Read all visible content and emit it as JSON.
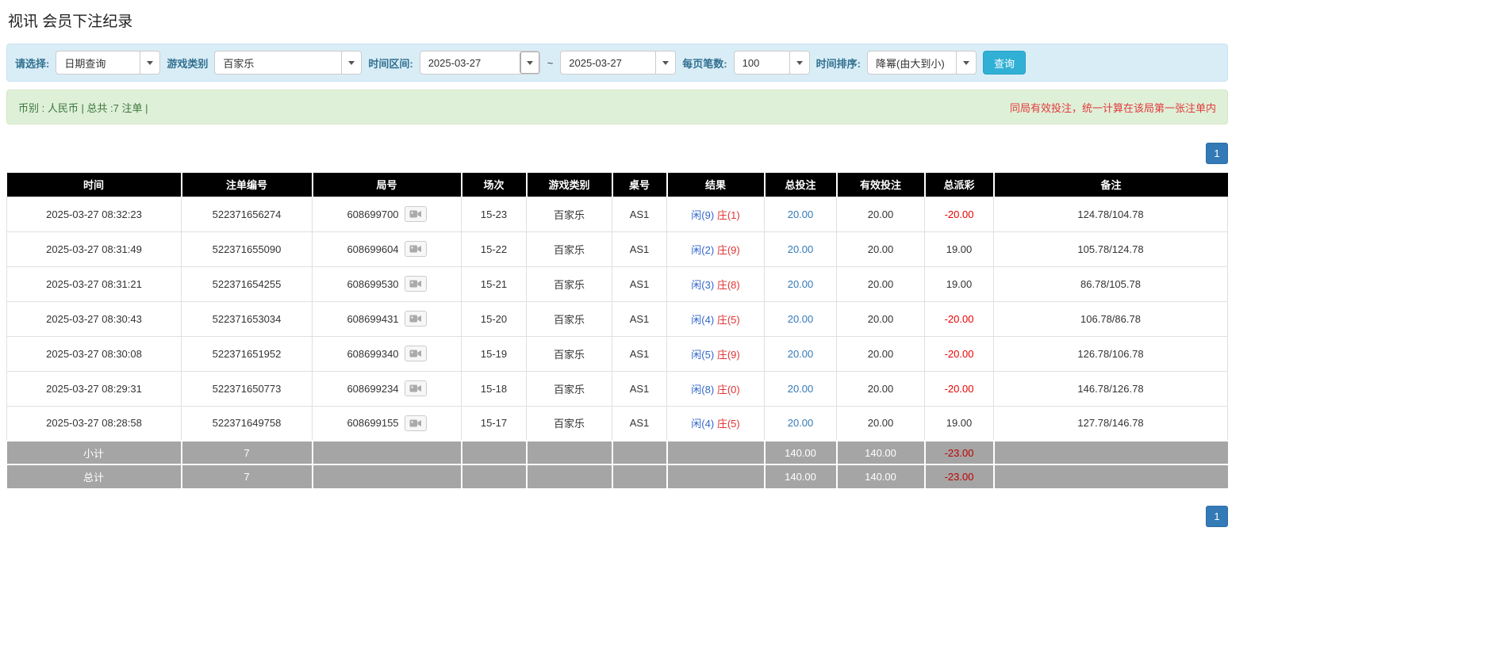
{
  "page": {
    "title": "视讯 会员下注纪录"
  },
  "filters": {
    "select_label": "请选择:",
    "select_value": "日期查询",
    "game_type_label": "游戏类别",
    "game_type_value": "百家乐",
    "time_range_label": "时间区间:",
    "date_from": "2025-03-27",
    "date_separator": "~",
    "date_to": "2025-03-27",
    "page_size_label": "每页笔数:",
    "page_size_value": "100",
    "sort_label": "时间排序:",
    "sort_value": "降幂(由大到小)",
    "query_button_label": "查询"
  },
  "summary_bar": {
    "left_text": "币别 : 人民币 | 总共 :7 注单 |",
    "right_notice": "同局有效投注，统一计算在该局第一张注单内"
  },
  "pagination": {
    "page": "1"
  },
  "table": {
    "headers": [
      "时间",
      "注单编号",
      "局号",
      "场次",
      "游戏类别",
      "桌号",
      "结果",
      "总投注",
      "有效投注",
      "总派彩",
      "备注"
    ],
    "rows": [
      {
        "time": "2025-03-27 08:32:23",
        "bet_id": "522371656274",
        "round_id": "608699700",
        "session": "15-23",
        "game": "百家乐",
        "table_no": "AS1",
        "result_player": "闲(9)",
        "result_banker": "庄(1)",
        "total_bet": "20.00",
        "valid_bet": "20.00",
        "payout": "-20.00",
        "note": "124.78/104.78"
      },
      {
        "time": "2025-03-27 08:31:49",
        "bet_id": "522371655090",
        "round_id": "608699604",
        "session": "15-22",
        "game": "百家乐",
        "table_no": "AS1",
        "result_player": "闲(2)",
        "result_banker": "庄(9)",
        "total_bet": "20.00",
        "valid_bet": "20.00",
        "payout": "19.00",
        "note": "105.78/124.78"
      },
      {
        "time": "2025-03-27 08:31:21",
        "bet_id": "522371654255",
        "round_id": "608699530",
        "session": "15-21",
        "game": "百家乐",
        "table_no": "AS1",
        "result_player": "闲(3)",
        "result_banker": "庄(8)",
        "total_bet": "20.00",
        "valid_bet": "20.00",
        "payout": "19.00",
        "note": "86.78/105.78"
      },
      {
        "time": "2025-03-27 08:30:43",
        "bet_id": "522371653034",
        "round_id": "608699431",
        "session": "15-20",
        "game": "百家乐",
        "table_no": "AS1",
        "result_player": "闲(4)",
        "result_banker": "庄(5)",
        "total_bet": "20.00",
        "valid_bet": "20.00",
        "payout": "-20.00",
        "note": "106.78/86.78"
      },
      {
        "time": "2025-03-27 08:30:08",
        "bet_id": "522371651952",
        "round_id": "608699340",
        "session": "15-19",
        "game": "百家乐",
        "table_no": "AS1",
        "result_player": "闲(5)",
        "result_banker": "庄(9)",
        "total_bet": "20.00",
        "valid_bet": "20.00",
        "payout": "-20.00",
        "note": "126.78/106.78"
      },
      {
        "time": "2025-03-27 08:29:31",
        "bet_id": "522371650773",
        "round_id": "608699234",
        "session": "15-18",
        "game": "百家乐",
        "table_no": "AS1",
        "result_player": "闲(8)",
        "result_banker": "庄(0)",
        "total_bet": "20.00",
        "valid_bet": "20.00",
        "payout": "-20.00",
        "note": "146.78/126.78"
      },
      {
        "time": "2025-03-27 08:28:58",
        "bet_id": "522371649758",
        "round_id": "608699155",
        "session": "15-17",
        "game": "百家乐",
        "table_no": "AS1",
        "result_player": "闲(4)",
        "result_banker": "庄(5)",
        "total_bet": "20.00",
        "valid_bet": "20.00",
        "payout": "19.00",
        "note": "127.78/146.78"
      }
    ],
    "subtotal": {
      "label": "小计",
      "count": "7",
      "total_bet": "140.00",
      "valid_bet": "140.00",
      "payout": "-23.00",
      "note": ""
    },
    "total": {
      "label": "总计",
      "count": "7",
      "total_bet": "140.00",
      "valid_bet": "140.00",
      "payout": "-23.00",
      "note": ""
    }
  },
  "icons": {
    "dropdown_caret": "caret-down",
    "round_replay": "video-camera"
  },
  "colors": {
    "filter_bar_bg": "#d9edf7",
    "filter_label": "#31708f",
    "info_bar_bg": "#dff0d8",
    "info_text_green": "#3c763d",
    "notice_red": "#e4393c",
    "header_bg": "#000000",
    "summary_row_bg": "#a5a5a5",
    "accent_blue": "#337ab7",
    "query_button_blue": "#31b0d5",
    "player_blue": "#3366cc",
    "banker_red": "#e03333",
    "negative_red": "#e60000"
  }
}
